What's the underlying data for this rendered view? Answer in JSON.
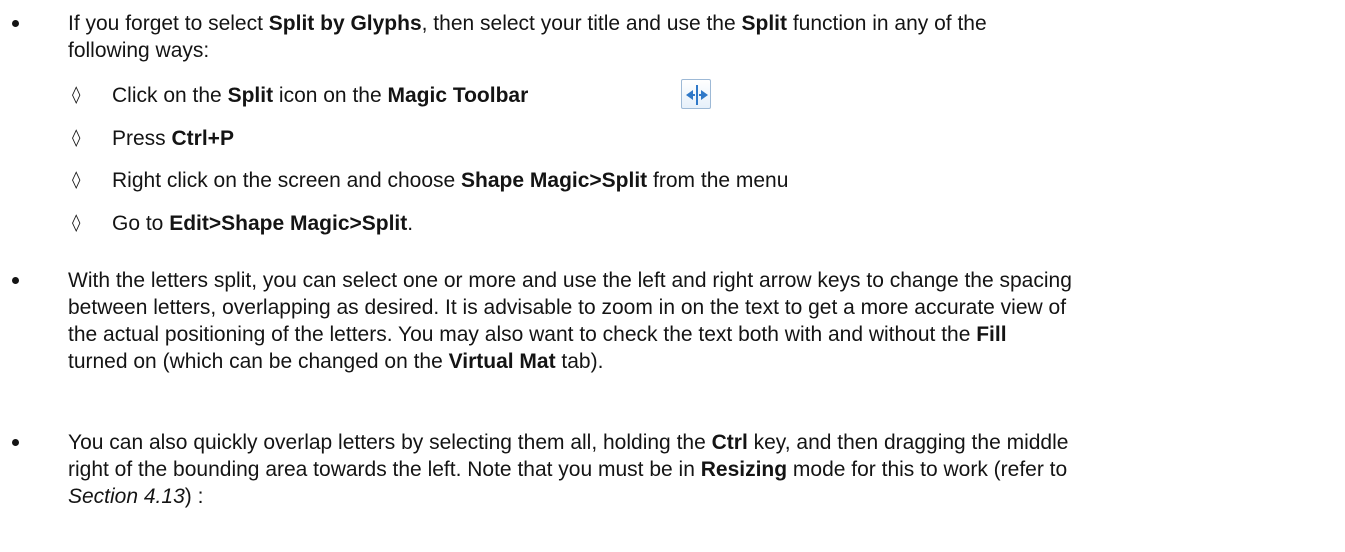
{
  "bullet1": {
    "line1": [
      "If you forget to select ",
      "Split by Glyphs",
      ", then select your title and use the ",
      "Split",
      " function in any of the"
    ],
    "line2": "following ways:"
  },
  "subitems": [
    {
      "parts": [
        "Click on the ",
        "Split",
        " icon on the ",
        "Magic Toolbar"
      ]
    },
    {
      "parts": [
        "Press ",
        "Ctrl+P"
      ]
    },
    {
      "parts": [
        "Right click on the screen and choose ",
        "Shape Magic>Split",
        " from the menu"
      ]
    },
    {
      "parts": [
        "Go to ",
        "Edit>Shape Magic>Split",
        "."
      ]
    }
  ],
  "split_icon": "split-horizontal-arrows-icon",
  "bullet2": {
    "line1": "With the letters split, you can select one or more and use the left and right arrow keys to change the spacing",
    "line2": "between letters, overlapping as desired. It is advisable to zoom in on the text to get a more accurate view of",
    "line3": [
      "the actual positioning of the letters. You may also want to check the text both with and without the ",
      "Fill"
    ],
    "line4": [
      "turned on (which can be changed on the ",
      "Virtual Mat",
      " tab)."
    ]
  },
  "bullet3": {
    "line1": [
      "You can also quickly overlap letters by selecting them all, holding the ",
      "Ctrl",
      " key, and then dragging the middle"
    ],
    "line2": [
      "right of the bounding area towards the left. Note that you must be in ",
      "Resizing",
      " mode for this to work (refer to"
    ],
    "line3": [
      "Section 4.13",
      ") :"
    ]
  },
  "colors": {
    "text": "#141414",
    "icon_arrow": "#2f78c8",
    "icon_border": "#9db9d6"
  }
}
